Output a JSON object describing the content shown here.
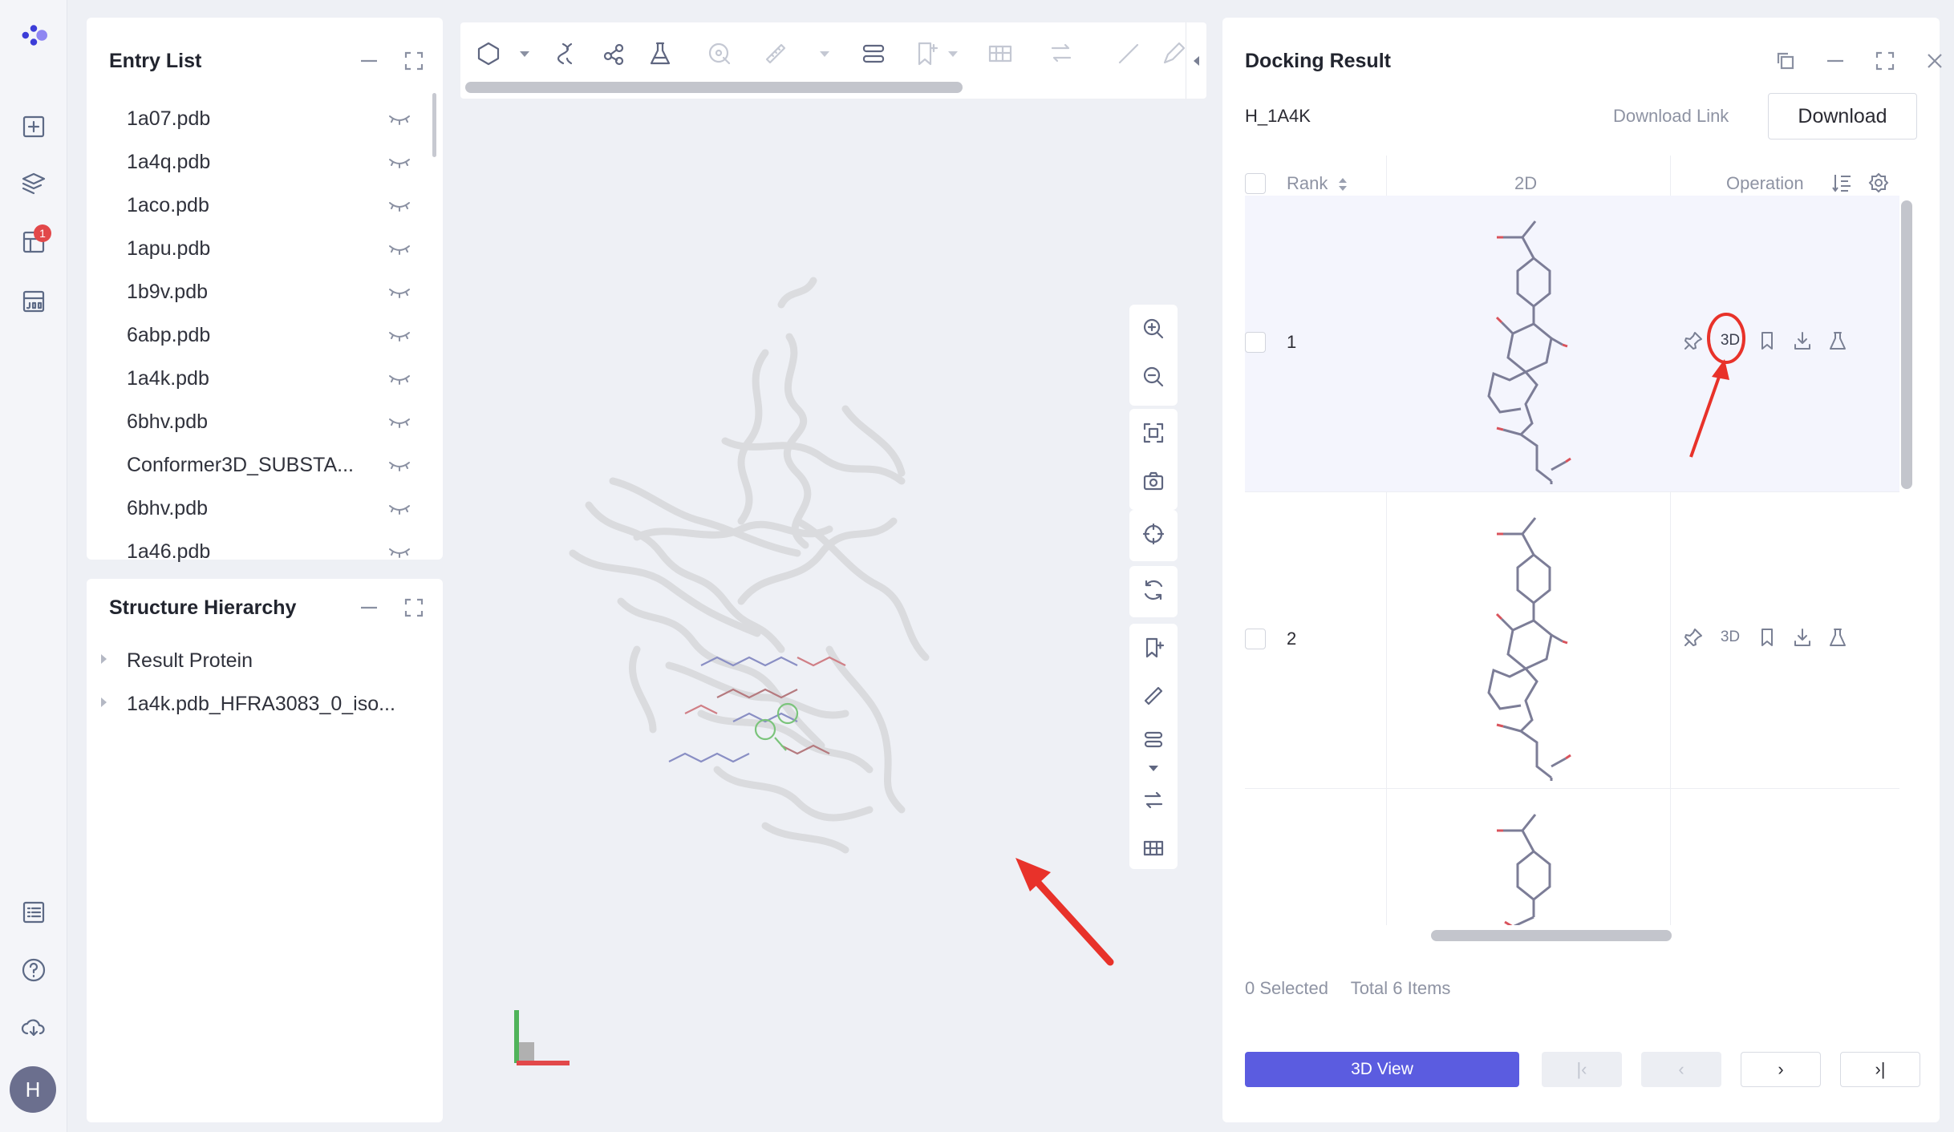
{
  "rail": {
    "badge_count": "1",
    "avatar_initial": "H",
    "icons": [
      "logo-icon",
      "new-file-icon",
      "layers-icon",
      "table-icon",
      "job-icon",
      "list-icon",
      "help-icon",
      "cloud-icon"
    ]
  },
  "entry_list": {
    "title": "Entry List",
    "items": [
      "1a07.pdb",
      "1a4q.pdb",
      "1aco.pdb",
      "1apu.pdb",
      "1b9v.pdb",
      "6abp.pdb",
      "1a4k.pdb",
      "6bhv.pdb",
      "Conformer3D_SUBSTA...",
      "6bhv.pdb",
      "1a46.pdb"
    ]
  },
  "structure_hierarchy": {
    "title": "Structure Hierarchy",
    "items": [
      "Result Protein",
      "1a4k.pdb_HFRA3083_0_iso..."
    ]
  },
  "docking": {
    "title": "Docking Result",
    "subtitle": "H_1A4K",
    "download_link": "Download Link",
    "download_button": "Download",
    "columns": {
      "rank": "Rank",
      "twod": "2D",
      "operation": "Operation"
    },
    "rows": [
      {
        "rank": "1",
        "op3d": "3D"
      },
      {
        "rank": "2",
        "op3d": "3D"
      }
    ],
    "selected_text": "0 Selected",
    "total_text": "Total 6 Items",
    "view_button": "3D View",
    "pager": {
      "next": "›",
      "last": "›|",
      "first": "|‹",
      "prev": "‹"
    }
  },
  "colors": {
    "accent": "#5b5ce0",
    "annotation_red": "#e8322a"
  }
}
